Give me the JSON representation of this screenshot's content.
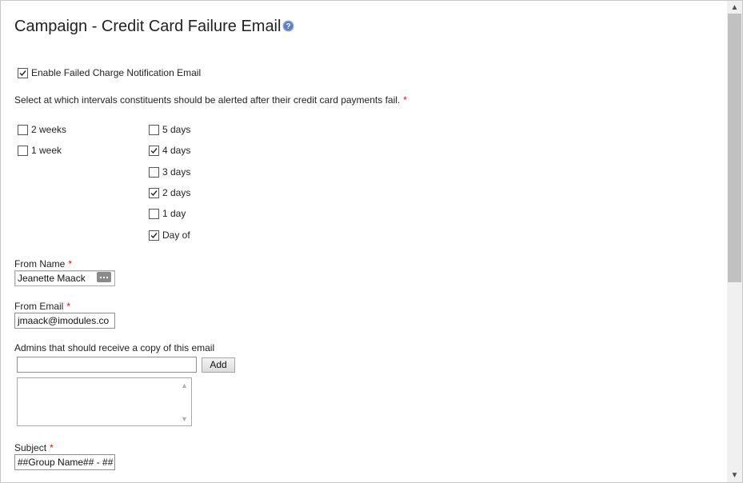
{
  "page": {
    "title": "Campaign - Credit Card Failure Email",
    "help_icon": "help-icon"
  },
  "enable": {
    "label": "Enable Failed Charge Notification Email",
    "checked": true
  },
  "intervals": {
    "prompt": "Select at which intervals constituents should be alerted after their credit card payments fail.",
    "required_mark": "*",
    "left_options": [
      {
        "label": "2 weeks",
        "checked": false
      },
      {
        "label": "1 week",
        "checked": false
      }
    ],
    "right_options": [
      {
        "label": "5 days",
        "checked": false
      },
      {
        "label": "4 days",
        "checked": true
      },
      {
        "label": "3 days",
        "checked": false
      },
      {
        "label": "2 days",
        "checked": true
      },
      {
        "label": "1 day",
        "checked": false
      },
      {
        "label": "Day of",
        "checked": true
      }
    ]
  },
  "from_name": {
    "label": "From Name",
    "required_mark": "*",
    "value": "Jeanette Maack",
    "icon": "contact-card-icon"
  },
  "from_email": {
    "label": "From Email",
    "required_mark": "*",
    "value": "jmaack@imodules.co"
  },
  "admins": {
    "label": "Admins that should receive a copy of this email",
    "input_value": "",
    "add_label": "Add"
  },
  "subject": {
    "label": "Subject",
    "required_mark": "*",
    "value": "##Group Name## - ##"
  },
  "scrollbar": {
    "up_icon": "chevron-up-icon",
    "down_icon": "chevron-down-icon"
  }
}
